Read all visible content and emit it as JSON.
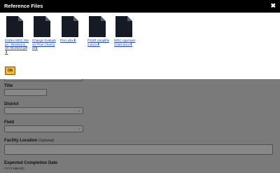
{
  "modal": {
    "title": "Reference Files",
    "close_glyph": "✖",
    "ok_label": "Ok",
    "files": [
      {
        "name": "EnDev MOC Steps - Revision1_10 .05.2022.pdf",
        "icon": "document-icon"
      },
      {
        "name": "Change Evaluation Flow Chart.pdf",
        "icon": "document-icon"
      },
      {
        "name": "PHA.xlsx",
        "icon": "document-icon"
      },
      {
        "name": "PSSR Simplified.docx",
        "icon": "document-icon"
      },
      {
        "name": "MOC Approver Chart.docx",
        "icon": "document-icon"
      }
    ],
    "download_glyph": "⬇"
  },
  "form": {
    "title_label": "Title",
    "district_label": "District",
    "field_label": "Field",
    "facility_label": "Facility Location",
    "facility_optional": "(Optional)",
    "completion_label": "Expected Completion Date",
    "completion_format": "YYYY MM-DD",
    "chevron": "⌄"
  },
  "colors": {
    "header_bg": "#000000",
    "link": "#1a44b8",
    "ok_button": "#f6b830",
    "overlay": "rgba(0,0,0,0.42)"
  }
}
